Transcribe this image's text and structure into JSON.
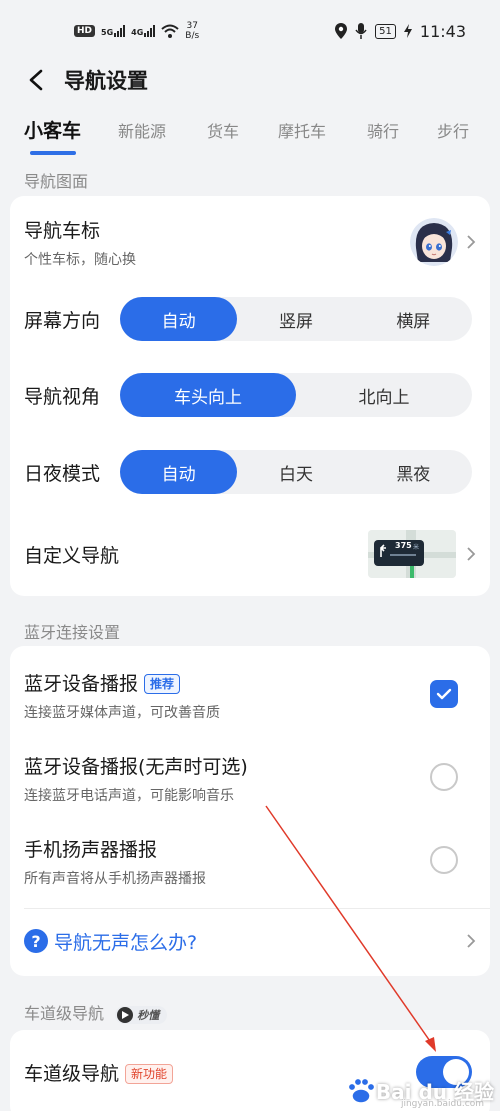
{
  "status_bar": {
    "hd_label": "HD",
    "sim1_label": "5G",
    "sim2_label": "4G",
    "net_speed_value": "37",
    "net_speed_unit": "B/s",
    "battery": "51",
    "time": "11:43"
  },
  "header": {
    "title": "导航设置"
  },
  "tabs": [
    {
      "label": "小客车",
      "active": true
    },
    {
      "label": "新能源",
      "active": false
    },
    {
      "label": "货车",
      "active": false
    },
    {
      "label": "摩托车",
      "active": false
    },
    {
      "label": "骑行",
      "active": false
    },
    {
      "label": "步行",
      "active": false
    }
  ],
  "nav_display": {
    "section_label": "导航图面",
    "car_icon": {
      "title": "导航车标",
      "subtitle": "个性车标，随心换"
    },
    "screen_orientation": {
      "label": "屏幕方向",
      "options": [
        "自动",
        "竖屏",
        "横屏"
      ],
      "selected": "自动"
    },
    "view_angle": {
      "label": "导航视角",
      "options": [
        "车头向上",
        "北向上"
      ],
      "selected": "车头向上"
    },
    "day_night": {
      "label": "日夜模式",
      "options": [
        "自动",
        "白天",
        "黑夜"
      ],
      "selected": "自动"
    },
    "custom_nav": {
      "title": "自定义导航",
      "thumb_distance": "375",
      "thumb_unit": "米"
    }
  },
  "bluetooth": {
    "section_label": "蓝牙连接设置",
    "options": [
      {
        "title": "蓝牙设备播报",
        "badge": "推荐",
        "subtitle": "连接蓝牙媒体声道，可改善音质",
        "checked": true
      },
      {
        "title": "蓝牙设备播报(无声时可选)",
        "subtitle": "连接蓝牙电话声道，可能影响音乐",
        "checked": false
      },
      {
        "title": "手机扬声器播报",
        "subtitle": "所有声音将从手机扬声器播报",
        "checked": false
      }
    ],
    "help_link": "导航无声怎么办?"
  },
  "lane_nav": {
    "section_label": "车道级导航",
    "video_badge": "秒懂",
    "title": "车道级导航",
    "badge": "新功能",
    "enabled": true
  },
  "watermark": {
    "text": "Bai du 经验",
    "sub": "jingyan.baidu.com"
  },
  "colors": {
    "accent": "#2b6de8",
    "annotation_arrow": "#e03a2a"
  }
}
